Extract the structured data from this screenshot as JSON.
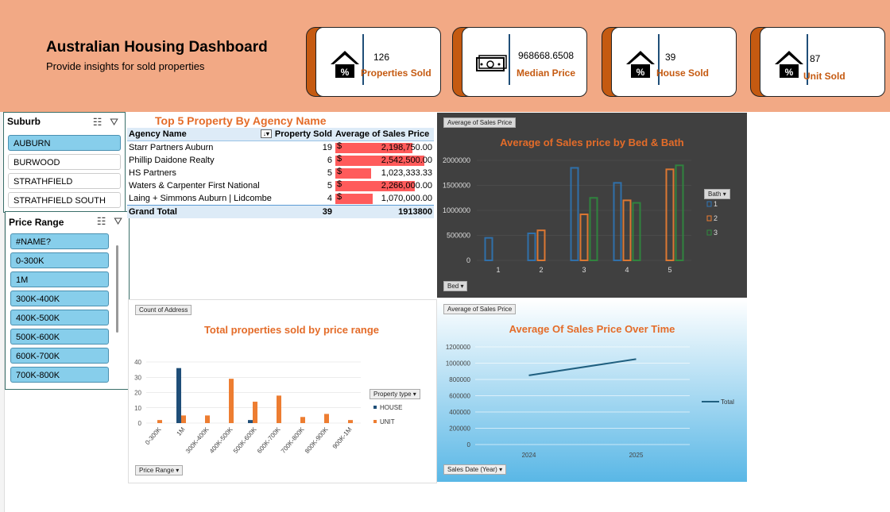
{
  "header": {
    "title": "Australian Housing Dashboard",
    "subtitle": "Provide insights for sold properties"
  },
  "kpis": [
    {
      "value": "126",
      "label": "Properties Sold",
      "icon": "house-percent-icon"
    },
    {
      "value": "968668.6508",
      "label": "Median Price",
      "icon": "money-icon"
    },
    {
      "value": "39",
      "label": "House Sold",
      "icon": "house-percent-icon"
    },
    {
      "value": "87",
      "label": "Unit Sold",
      "icon": "house-percent-icon"
    }
  ],
  "suburb_slicer": {
    "title": "Suburb",
    "items": [
      {
        "label": "AUBURN",
        "selected": true
      },
      {
        "label": "BURWOOD",
        "selected": false
      },
      {
        "label": "STRATHFIELD",
        "selected": false
      },
      {
        "label": "STRATHFIELD SOUTH",
        "selected": false
      }
    ]
  },
  "price_slicer": {
    "title": "Price Range",
    "items": [
      {
        "label": "#NAME?"
      },
      {
        "label": "0-300K"
      },
      {
        "label": "1M"
      },
      {
        "label": "300K-400K"
      },
      {
        "label": "400K-500K"
      },
      {
        "label": "500K-600K"
      },
      {
        "label": "600K-700K"
      },
      {
        "label": "700K-800K"
      }
    ]
  },
  "pivot": {
    "title": "Top 5 Property By Agency Name",
    "headers": [
      "Agency Name",
      "Property Sold",
      "Average of Sales Price"
    ],
    "rows": [
      {
        "agency": "Starr Partners Auburn",
        "sold": "19",
        "price": "2,198,750.00",
        "value": 2198750
      },
      {
        "agency": "Phillip Daidone Realty",
        "sold": "6",
        "price": "2,542,500.00",
        "value": 2542500
      },
      {
        "agency": "HS Partners",
        "sold": "5",
        "price": "1,023,333.33",
        "value": 1023333.33
      },
      {
        "agency": "Waters & Carpenter First National",
        "sold": "5",
        "price": "2,266,000.00",
        "value": 2266000
      },
      {
        "agency": "Laing + Simmons Auburn | Lidcombe",
        "sold": "4",
        "price": "1,070,000.00",
        "value": 1070000
      }
    ],
    "total": {
      "label": "Grand Total",
      "sold": "39",
      "price": "1913800"
    },
    "currency": "$",
    "bar_color": "#ff5b5b"
  },
  "chart_data": [
    {
      "type": "bar",
      "title": "Average of Sales price by Bed & Bath",
      "field_button": "Average of Sales Price",
      "axis_button": "Bed",
      "legend_title": "Bath",
      "legend_placement": "right",
      "categories": [
        "1",
        "2",
        "3",
        "4",
        "5"
      ],
      "ylim": [
        0,
        2000000
      ],
      "yticks": [
        "0",
        "500000",
        "1000000",
        "1500000",
        "2000000"
      ],
      "series": [
        {
          "name": "1",
          "color": "#2e75b6",
          "values": [
            450000,
            540000,
            1850000,
            1550000,
            null
          ]
        },
        {
          "name": "2",
          "color": "#ed7d31",
          "values": [
            null,
            600000,
            920000,
            1200000,
            1820000
          ]
        },
        {
          "name": "3",
          "color": "#2e8b3e",
          "values": [
            null,
            null,
            1250000,
            1150000,
            1900000
          ]
        }
      ]
    },
    {
      "type": "bar",
      "title": "Total properties sold by price range",
      "field_button": "Count of Address",
      "axis_button": "Price Range",
      "legend_title": "Property type",
      "legend_placement": "right",
      "categories": [
        "0-300K",
        "1M",
        "300K-400K",
        "400K-500K",
        "500K-600K",
        "600K-700K",
        "700K-800K",
        "800K-900K",
        "900K-1M"
      ],
      "ylim": [
        0,
        40
      ],
      "yticks": [
        "0",
        "10",
        "20",
        "30",
        "40"
      ],
      "series": [
        {
          "name": "HOUSE",
          "color": "#1f4e78",
          "values": [
            0,
            36,
            0,
            0,
            2,
            0,
            0,
            0,
            0
          ]
        },
        {
          "name": "UNIT",
          "color": "#ed7d31",
          "values": [
            2,
            5,
            5,
            29,
            14,
            18,
            4,
            6,
            2
          ]
        }
      ]
    },
    {
      "type": "line",
      "title": "Average Of Sales Price Over Time",
      "field_button": "Average of Sales Price",
      "axis_button": "Sales Date (Year)",
      "legend_placement": "right",
      "categories": [
        "2024",
        "2025"
      ],
      "ylim": [
        0,
        1200000
      ],
      "yticks": [
        "0",
        "200000",
        "400000",
        "600000",
        "800000",
        "1000000",
        "1200000"
      ],
      "series": [
        {
          "name": "Total",
          "color": "#1f5f7f",
          "values": [
            850000,
            1050000
          ]
        }
      ]
    }
  ]
}
